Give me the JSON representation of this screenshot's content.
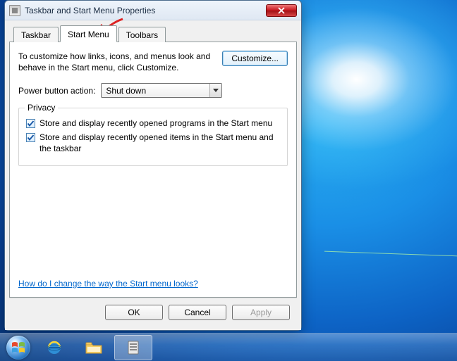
{
  "window": {
    "title": "Taskbar and Start Menu Properties",
    "tabs": [
      "Taskbar",
      "Start Menu",
      "Toolbars"
    ],
    "active_tab_index": 1,
    "intro": "To customize how links, icons, and menus look and behave in the Start menu, click Customize.",
    "customize_label": "Customize...",
    "power_label": "Power button action:",
    "power_value": "Shut down",
    "privacy": {
      "legend": "Privacy",
      "opt1": {
        "checked": true,
        "label": "Store and display recently opened programs in the Start menu"
      },
      "opt2": {
        "checked": true,
        "label": "Store and display recently opened items in the Start menu and the taskbar"
      }
    },
    "help_link": "How do I change the way the Start menu looks?",
    "buttons": {
      "ok": "OK",
      "cancel": "Cancel",
      "apply": "Apply"
    }
  },
  "taskbar_items": [
    "start",
    "ie",
    "explorer",
    "properties-dialog"
  ]
}
